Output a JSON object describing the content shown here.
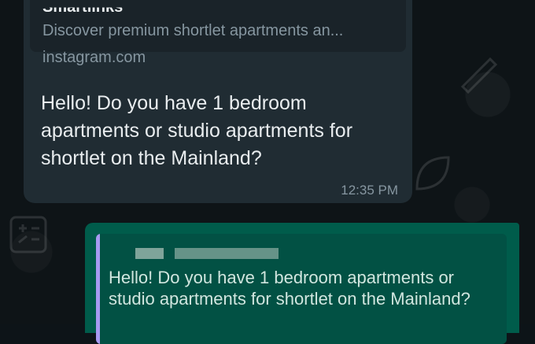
{
  "incoming_message": {
    "link_preview": {
      "site_name": "Smartlinks",
      "description": "Discover premium shortlet apartments an...",
      "domain": "instagram.com"
    },
    "text": "Hello! Do you have 1 bedroom apartments or studio apartments for shortlet on the Mainland?",
    "time": "12:35 PM"
  },
  "outgoing_message": {
    "quoted": {
      "text": "Hello! Do you have 1 bedroom apartments or studio apartments for shortlet on the Mainland?"
    }
  },
  "colors": {
    "chat_background": "#0e1417",
    "incoming_bubble": "#202c33",
    "outgoing_bubble": "#005c4b",
    "quote_accent": "#a79af2"
  },
  "icons": [
    "pencil-icon",
    "leaf-icon",
    "calculator-icon"
  ]
}
